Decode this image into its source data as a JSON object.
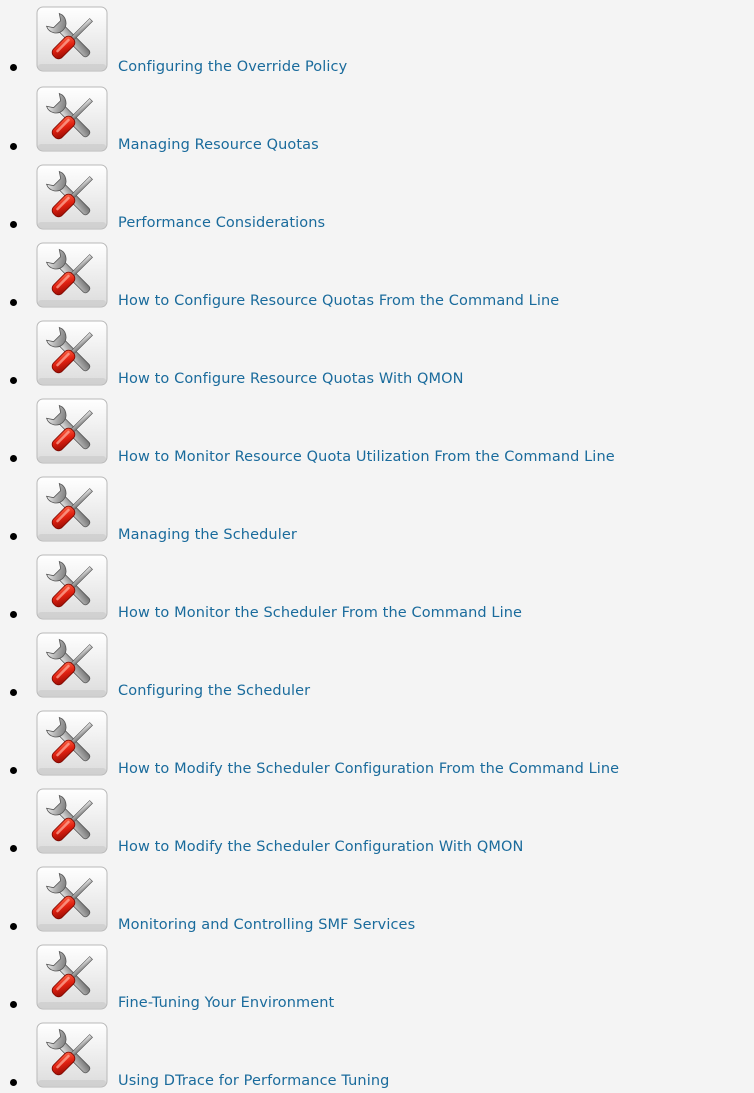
{
  "colors": {
    "link": "#1a6b9c",
    "background": "#f4f4f4",
    "bullet": "#000000"
  },
  "icon": "tools-icon",
  "tasks": [
    {
      "label": "Configuring the Override Policy"
    },
    {
      "label": "Managing Resource Quotas"
    },
    {
      "label": "Performance Considerations"
    },
    {
      "label": "How to Configure Resource Quotas From the Command Line"
    },
    {
      "label": "How to Configure Resource Quotas With QMON"
    },
    {
      "label": "How to Monitor Resource Quota Utilization From the Command Line"
    },
    {
      "label": "Managing the Scheduler"
    },
    {
      "label": "How to Monitor the Scheduler From the Command Line"
    },
    {
      "label": "Configuring the Scheduler"
    },
    {
      "label": "How to Modify the Scheduler Configuration From the Command Line"
    },
    {
      "label": "How to Modify the Scheduler Configuration With QMON"
    },
    {
      "label": "Monitoring and Controlling SMF Services"
    },
    {
      "label": "Fine-Tuning Your Environment"
    },
    {
      "label": "Using DTrace for Performance Tuning"
    }
  ]
}
